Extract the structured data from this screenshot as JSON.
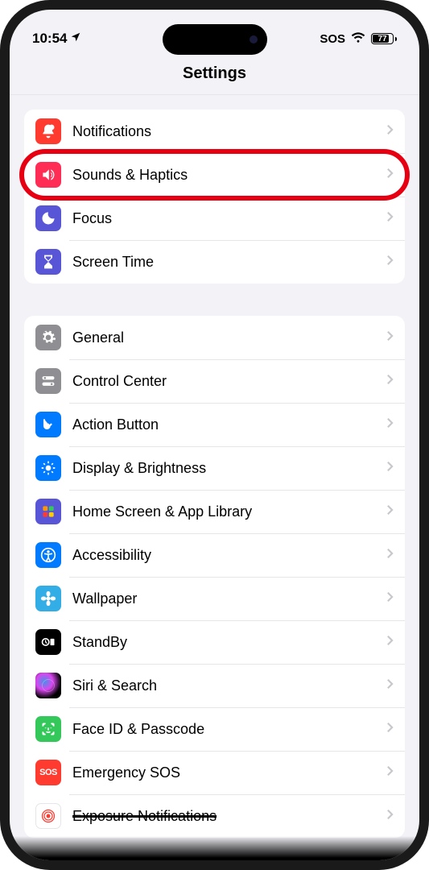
{
  "status": {
    "time": "10:54",
    "sos": "SOS",
    "battery": "77"
  },
  "header": {
    "title": "Settings"
  },
  "group1": [
    {
      "label": "Notifications",
      "icon": "bell-badge-icon",
      "color": "ic-red",
      "highlighted": false
    },
    {
      "label": "Sounds & Haptics",
      "icon": "speaker-icon",
      "color": "ic-pink",
      "highlighted": true
    },
    {
      "label": "Focus",
      "icon": "moon-icon",
      "color": "ic-indigo",
      "highlighted": false
    },
    {
      "label": "Screen Time",
      "icon": "hourglass-icon",
      "color": "ic-indigo",
      "highlighted": false
    }
  ],
  "group2": [
    {
      "label": "General",
      "icon": "gear-icon",
      "color": "ic-gray"
    },
    {
      "label": "Control Center",
      "icon": "switches-icon",
      "color": "ic-gray"
    },
    {
      "label": "Action Button",
      "icon": "action-icon",
      "color": "ic-blue"
    },
    {
      "label": "Display & Brightness",
      "icon": "sun-icon",
      "color": "ic-blue"
    },
    {
      "label": "Home Screen & App Library",
      "icon": "grid-icon",
      "color": "ic-multi"
    },
    {
      "label": "Accessibility",
      "icon": "person-circle-icon",
      "color": "ic-blue"
    },
    {
      "label": "Wallpaper",
      "icon": "flower-icon",
      "color": "ic-lightblue"
    },
    {
      "label": "StandBy",
      "icon": "standby-icon",
      "color": "ic-black"
    },
    {
      "label": "Siri & Search",
      "icon": "siri-icon",
      "color": "ic-siri"
    },
    {
      "label": "Face ID & Passcode",
      "icon": "faceid-icon",
      "color": "ic-green"
    },
    {
      "label": "Emergency SOS",
      "icon": "sos-icon",
      "color": "ic-red"
    },
    {
      "label": "Exposure Notifications",
      "icon": "exposure-icon",
      "color": "ic-white"
    }
  ]
}
